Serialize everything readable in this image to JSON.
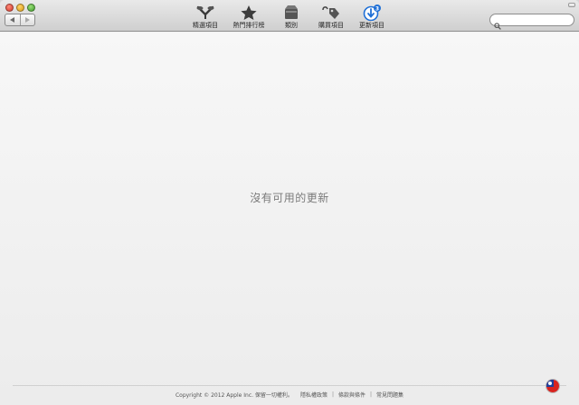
{
  "toolbar": {
    "tabs": [
      {
        "label": "精選項目",
        "icon": "featured-icon"
      },
      {
        "label": "熱門排行榜",
        "icon": "star-icon"
      },
      {
        "label": "類別",
        "icon": "categories-icon"
      },
      {
        "label": "購買項目",
        "icon": "purchased-tag-icon"
      },
      {
        "label": "更新項目",
        "icon": "updates-icon"
      }
    ],
    "updates_badge": "3",
    "search": {
      "value": "",
      "placeholder": ""
    }
  },
  "main": {
    "empty_message": "沒有可用的更新"
  },
  "footer": {
    "copyright": "Copyright © 2012 Apple Inc. 保留一切權利。",
    "links": [
      "隱私權政策",
      "條款與條件",
      "常見問題集"
    ],
    "separator": "|"
  },
  "colors": {
    "accent": "#1f6fd6",
    "close": "#d0392b",
    "minimize": "#d89b16",
    "zoom": "#3e9a2a"
  }
}
